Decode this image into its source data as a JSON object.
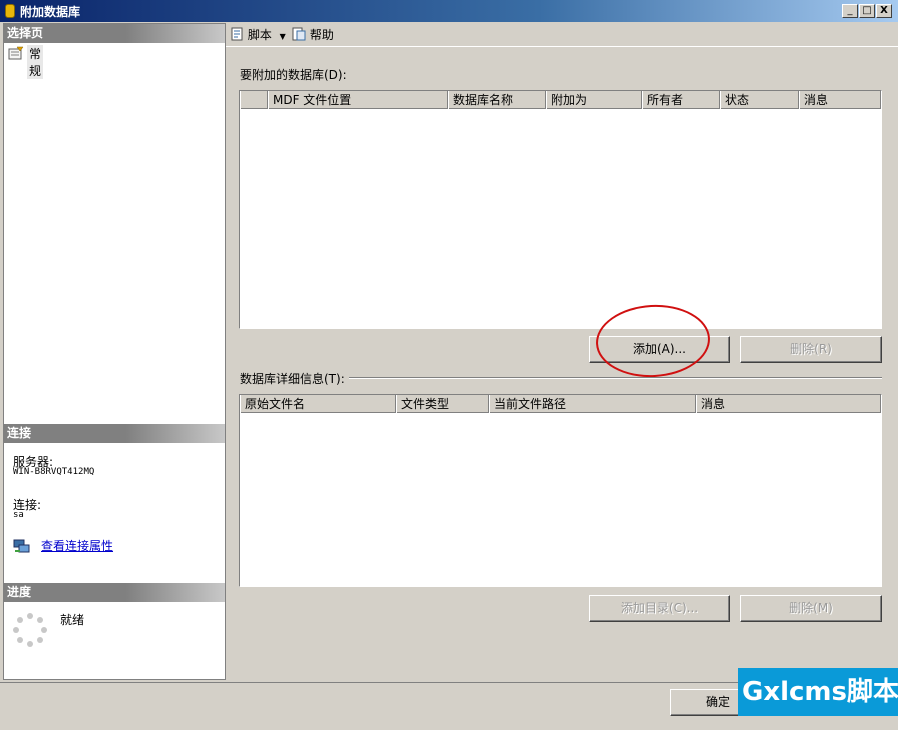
{
  "window": {
    "title": "附加数据库",
    "min": "_",
    "max": "□",
    "close": "X"
  },
  "left": {
    "select_page_header": "选择页",
    "pages": [
      "常规"
    ],
    "connection_header": "连接",
    "server_label": "服务器:",
    "server_value": "WIN-B8RVQT412MQ",
    "connection_label": "连接:",
    "connection_value": "sa",
    "view_props_link": "查看连接属性",
    "progress_header": "进度",
    "progress_status": "就绪"
  },
  "toolbar": {
    "script_label": "脚本",
    "help_label": "帮助"
  },
  "attach": {
    "label": "要附加的数据库(D):",
    "columns": [
      "",
      "MDF 文件位置",
      "数据库名称",
      "附加为",
      "所有者",
      "状态",
      "消息"
    ],
    "add_button": "添加(A)...",
    "remove_button": "删除(R)"
  },
  "details": {
    "label": "数据库详细信息(T):",
    "columns": [
      "原始文件名",
      "文件类型",
      "当前文件路径",
      "消息"
    ],
    "add_catalog_button": "添加目录(C)...",
    "remove_button": "删除(M)"
  },
  "footer": {
    "ok_button": "确定"
  },
  "watermark": {
    "text": "Gxlcms脚本"
  },
  "colors": {
    "title_bar": "#0a246a",
    "annotation": "#d01010",
    "watermark_bg": "#0a9ad8",
    "link": "#0000cc"
  }
}
